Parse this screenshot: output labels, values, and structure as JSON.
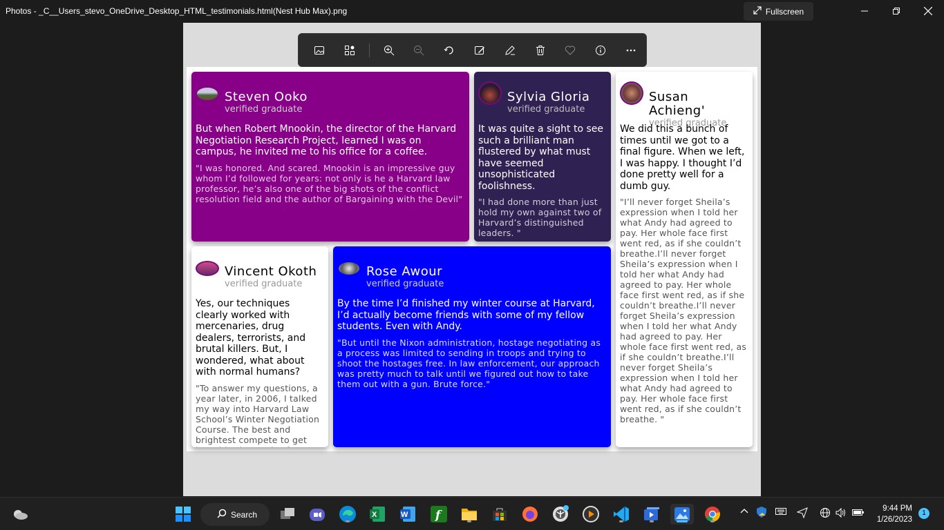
{
  "window": {
    "title": "Photos - _C__Users_stevo_OneDrive_Desktop_HTML_testimonials.html(Nest Hub Max).png",
    "fullscreen_label": "Fullscreen"
  },
  "toolbar": {
    "buttons": [
      "image-icon",
      "gallery-icon",
      "zoom-in-icon",
      "zoom-out-icon",
      "rotate-icon",
      "edit-image-icon",
      "draw-icon",
      "delete-icon",
      "favorite-icon",
      "info-icon",
      "more-icon"
    ]
  },
  "testimonials": [
    {
      "name": "Steven Ooko",
      "verified": "verified graduate",
      "lead": "But when Robert Mnookin, the director of the Harvard Negotiation Research Project, learned I was on campus, he invited me to his office for a coffee.",
      "quote": "\"I was honored. And scared. Mnookin is an impressive guy whom I’d followed for years: not only is he a Harvard law professor, he’s also one of the big shots of the conflict resolution field and the author of Bargaining with the Devil\"",
      "color": "#880088"
    },
    {
      "name": "Sylvia Gloria",
      "verified": "verified graduate",
      "lead": "It was quite a sight to see such a brilliant man flustered by what must have seemed unsophisticated foolishness.",
      "quote": "\"I had done more than just hold my own against two of Harvard’s distinguished leaders. \"",
      "color": "#2f2152"
    },
    {
      "name": "Susan Achieng'",
      "verified": "verified graduate",
      "lead": "We did this a bunch of times until we got to a final figure. When we left, I was happy. I thought I’d done pretty well for a dumb guy.",
      "quote": "\"I’ll never forget Sheila’s expression when I told her what Andy had agreed to pay. Her whole face first went red, as if she couldn’t breathe.I’ll never forget Sheila’s expression when I told her what Andy had agreed to pay. Her whole face first went red, as if she couldn’t breathe.I’ll never forget Sheila’s expression when I told her what Andy had agreed to pay. Her whole face first went red, as if she couldn’t breathe.I’ll never forget Sheila’s expression when I told her what Andy had agreed to pay. Her whole face first went red, as if she couldn’t breathe. \"",
      "color": "#ffffff"
    },
    {
      "name": "Vincent Okoth",
      "verified": "verified graduate",
      "lead": "Yes, our techniques clearly worked with mercenaries, drug dealers, terrorists, and brutal killers. But, I wondered, what about with normal humans?",
      "quote": "\"To answer my questions, a year later, in 2006, I talked my way into Harvard Law School’s Winter Negotiation Course. The best and brightest compete to get into this classand Tufts.\"",
      "color": "#ffffff"
    },
    {
      "name": "Rose Awour",
      "verified": "verified graduate",
      "lead": "By the time I’d finished my winter course at Harvard, I’d actually become friends with some of my fellow students. Even with Andy.",
      "quote": "\"But until the Nixon administration, hostage negotiating as a process was limited to sending in troops and trying to shoot the hostages free. In law enforcement, our approach was pretty much to talk until we figured out how to take them out with a gun. Brute force.\"",
      "color": "#0000ff"
    }
  ],
  "taskbar": {
    "search_label": "Search",
    "apps": [
      "start-icon",
      "task-view-icon",
      "teams-icon",
      "edge-icon",
      "excel-icon",
      "word-icon",
      "formula-app-icon",
      "file-explorer-icon",
      "store-icon",
      "firefox-icon",
      "git-icon",
      "media-player-icon",
      "vscode-icon",
      "video-editor-icon",
      "photos-icon",
      "chrome-icon"
    ],
    "time": "9:44 PM",
    "date": "1/26/2023",
    "notification_count": "1"
  }
}
